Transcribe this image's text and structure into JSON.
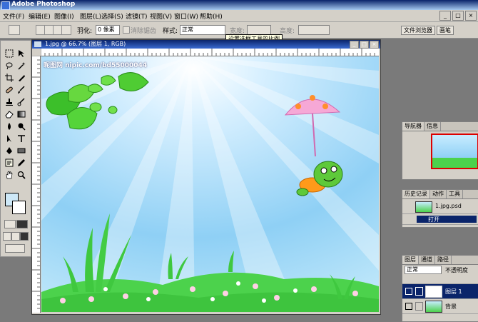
{
  "app": {
    "title": "Adobe Photoshop"
  },
  "menu": [
    "文件(F)",
    "编辑(E)",
    "图像(I)",
    "图层(L)",
    "选择(S)",
    "滤镜(T)",
    "视图(V)",
    "窗口(W)",
    "帮助(H)"
  ],
  "options": {
    "feather_label": "羽化:",
    "feather_value": "0 像素",
    "antialias_label": "消除锯齿",
    "style_label": "样式:",
    "style_value": "正常",
    "width_label": "宽度:",
    "height_label": "高度:"
  },
  "palette_well": [
    "文件浏览器",
    "画笔"
  ],
  "tooltip": "设置选框工具的比例",
  "document": {
    "title": "1.jpg @ 66.7% (图层 1, RGB)",
    "watermark": "昵图网 nipic.com/bd55000044"
  },
  "panels": {
    "navigator_tabs": [
      "导航器",
      "信息"
    ],
    "history_tabs": [
      "历史记录",
      "动作",
      "工具"
    ],
    "history_snapshot": "1.jpg.psd",
    "history_step": "打开",
    "layers_tabs": [
      "图层",
      "通道",
      "路径"
    ],
    "blend_mode": "正常",
    "opacity": "不透明度",
    "layers": [
      {
        "name": "图层 1"
      },
      {
        "name": "背景"
      }
    ]
  },
  "colors": {
    "accent": "#0a246a",
    "sky": "#8fd0f5",
    "grass": "#4cd24c"
  }
}
